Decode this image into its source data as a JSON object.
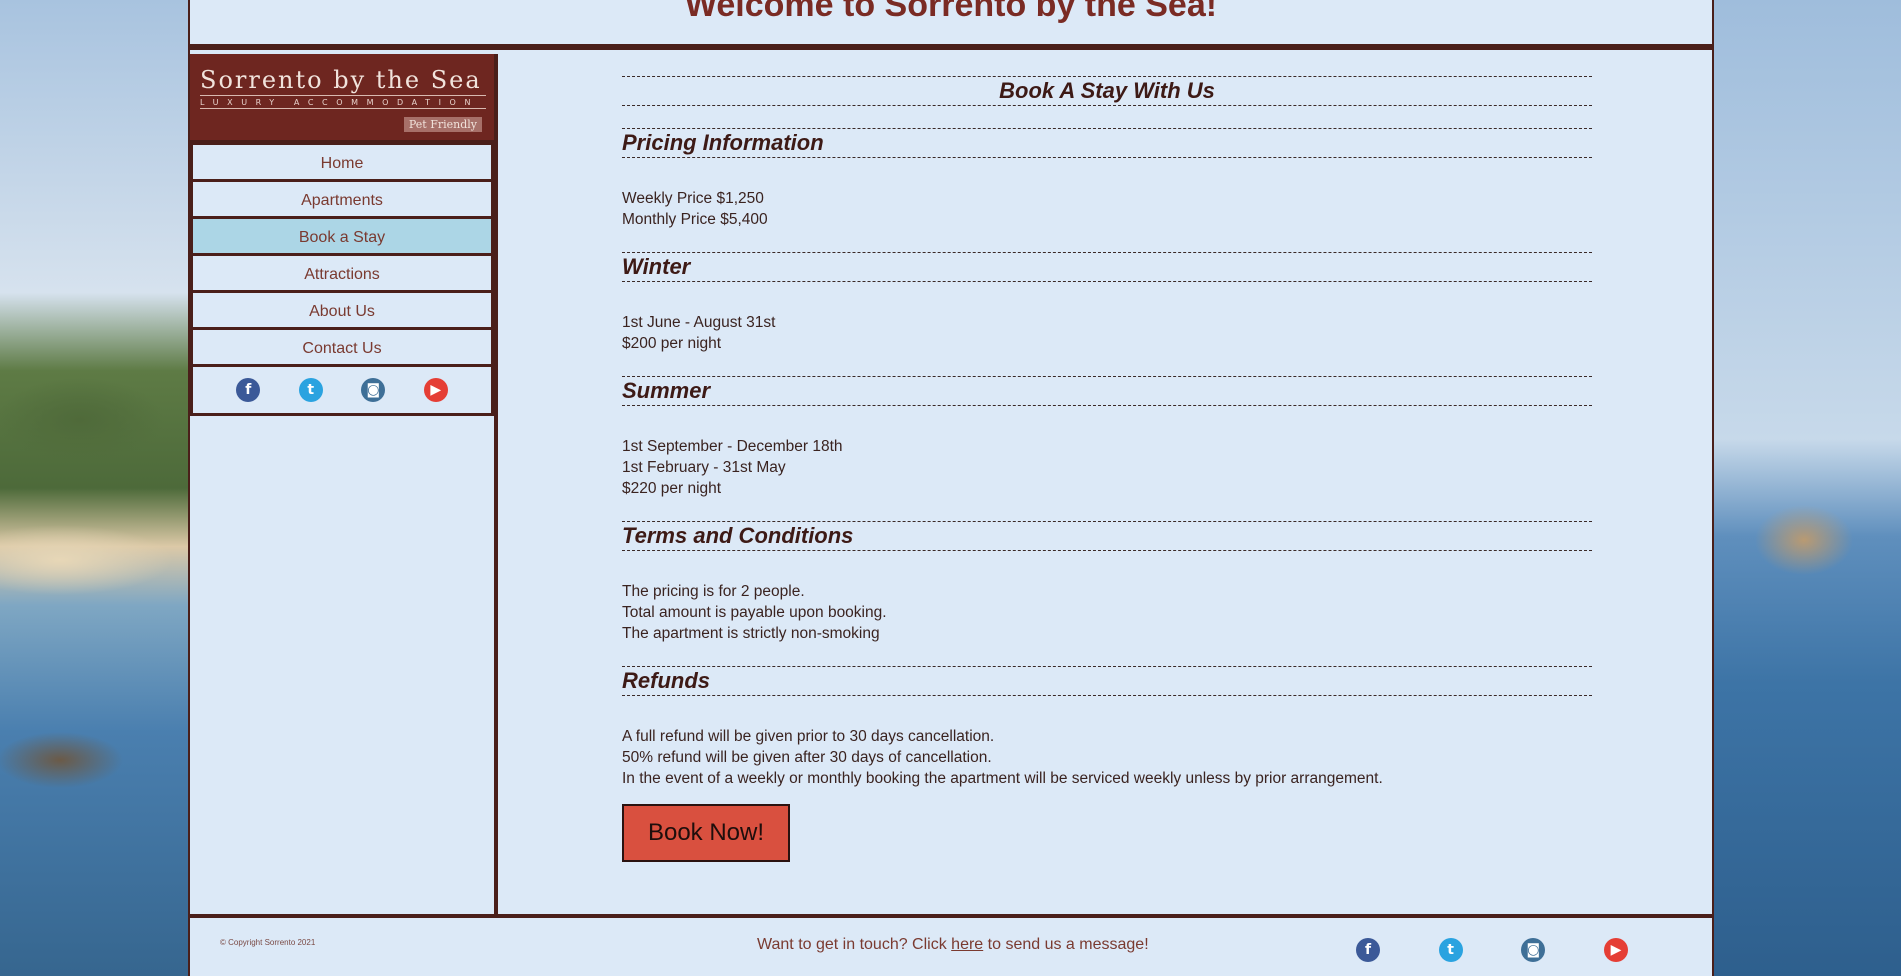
{
  "header": {
    "title": "Welcome to Sorrento by the Sea!"
  },
  "logo": {
    "brand": "Sorrento by the Sea",
    "tagline": "LUXURY ACCOMMODATION",
    "badge": "Pet Friendly"
  },
  "nav": {
    "items": [
      {
        "label": "Home"
      },
      {
        "label": "Apartments"
      },
      {
        "label": "Book a Stay",
        "active": true
      },
      {
        "label": "Attractions"
      },
      {
        "label": "About Us"
      },
      {
        "label": "Contact Us"
      }
    ]
  },
  "social": {
    "facebook": "f",
    "twitter": "t",
    "instagram": "◙",
    "youtube": "▶"
  },
  "main": {
    "heading": "Book A Stay With Us",
    "sections": [
      {
        "title": "Pricing Information",
        "lines": [
          "Weekly Price $1,250",
          "Monthly Price $5,400"
        ]
      },
      {
        "title": "Winter",
        "lines": [
          "1st June - August 31st",
          "$200 per night"
        ]
      },
      {
        "title": "Summer",
        "lines": [
          "1st September - December 18th",
          "1st February - 31st May",
          "$220 per night"
        ]
      },
      {
        "title": "Terms and Conditions",
        "lines": [
          "The pricing is for 2 people.",
          "Total amount is payable upon booking.",
          "The apartment is strictly non-smoking"
        ]
      },
      {
        "title": "Refunds",
        "lines": [
          "A full refund will be given prior to 30 days cancellation.",
          "50% refund will be given after 30 days of cancellation.",
          "In the event of a weekly or monthly booking the apartment will be serviced weekly unless by prior arrangement."
        ]
      }
    ],
    "book_button": "Book Now!"
  },
  "footer": {
    "copyright": "© Copyright Sorrento 2021",
    "contact_prefix": "Want to get in touch? Click ",
    "contact_link": "here",
    "contact_suffix": " to send us a message!"
  },
  "colors": {
    "accent": "#6e2620",
    "border": "#4a1f1a",
    "background": "#dce9f7",
    "active_nav": "#acd6e6",
    "book_button": "#d9503f"
  }
}
